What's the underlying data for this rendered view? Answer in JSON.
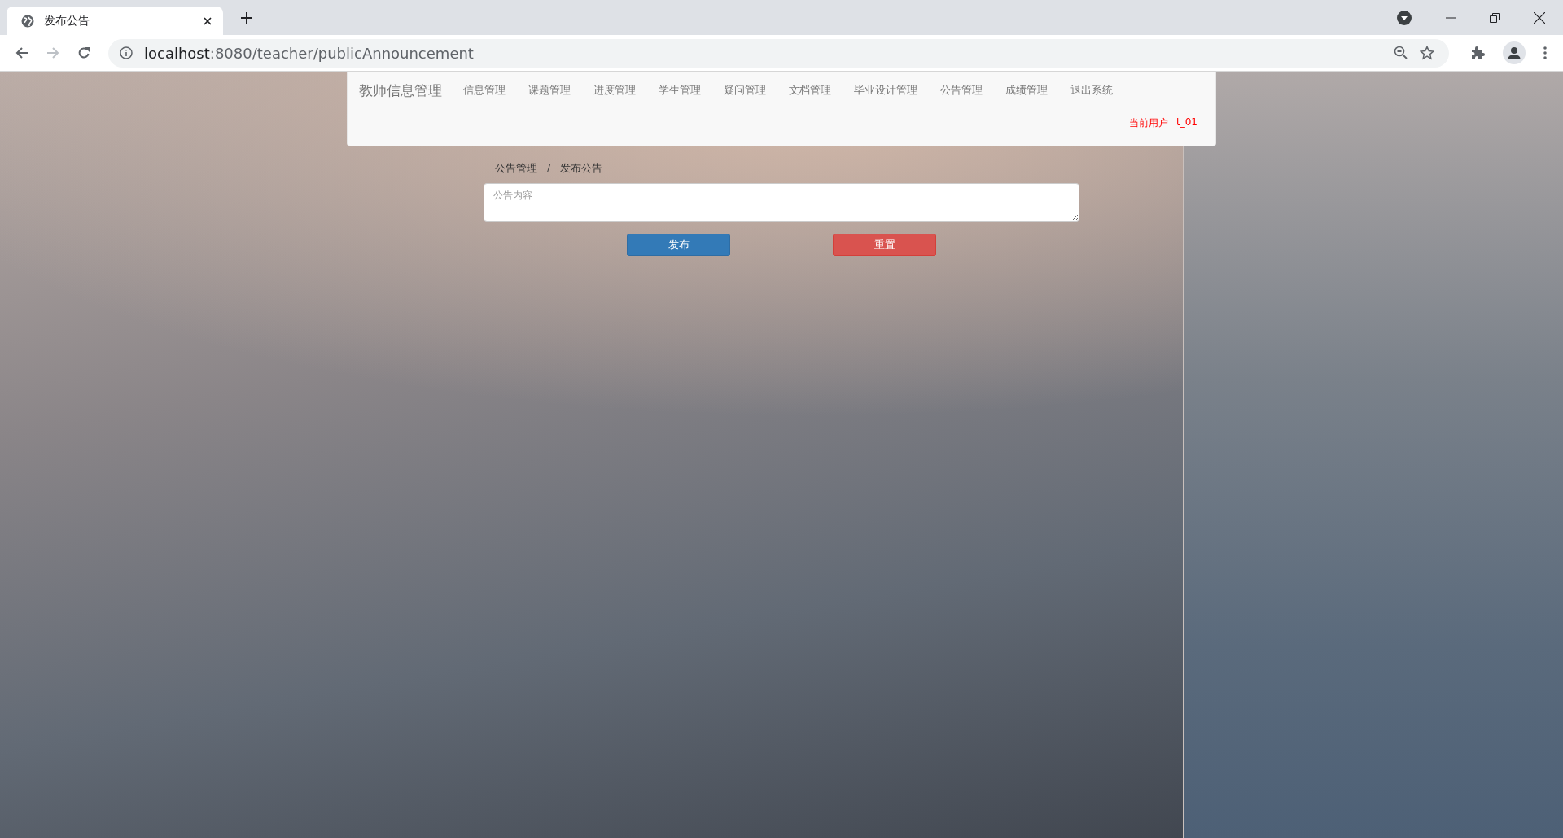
{
  "browser": {
    "tab_title": "发布公告",
    "url_host": "localhost",
    "url_rest": ":8080/teacher/publicAnnouncement"
  },
  "nav": {
    "brand": "教师信息管理",
    "items": [
      {
        "label": "信息管理"
      },
      {
        "label": "课题管理"
      },
      {
        "label": "进度管理"
      },
      {
        "label": "学生管理"
      },
      {
        "label": "疑问管理"
      },
      {
        "label": "文档管理"
      },
      {
        "label": "毕业设计管理"
      },
      {
        "label": "公告管理"
      },
      {
        "label": "成绩管理"
      },
      {
        "label": "退出系统"
      }
    ],
    "user_label": "当前用户",
    "user_name": "t_01"
  },
  "breadcrumb": {
    "items": [
      "公告管理",
      "发布公告"
    ],
    "separator": "/"
  },
  "form": {
    "placeholder": "公告内容",
    "buttons": [
      {
        "label": "发布",
        "kind": "primary"
      },
      {
        "label": "重置",
        "kind": "danger"
      }
    ]
  }
}
